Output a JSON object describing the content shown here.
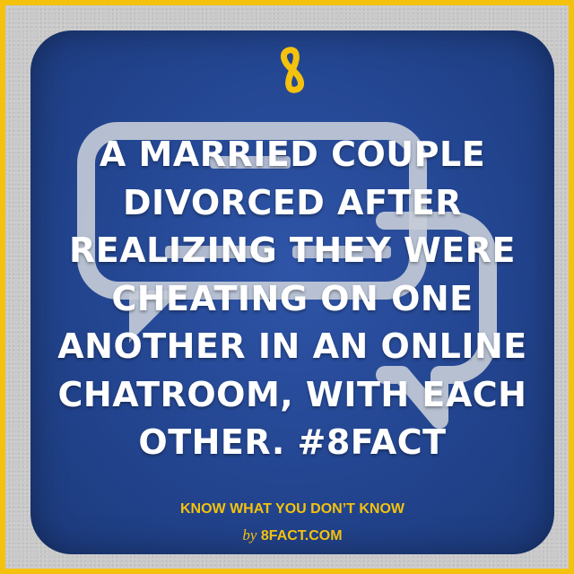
{
  "logo": {
    "icon": "8fact-logo-icon",
    "color": "#f4c20d"
  },
  "fact": {
    "lines": [
      "A MARRIED COUPLE",
      "DIVORCED AFTER",
      "REALIZING THEY WERE",
      "CHEATING ON ONE",
      "ANOTHER IN AN ONLINE",
      "CHATROOM, WITH EACH",
      "OTHER. #8FACT"
    ]
  },
  "footer": {
    "tagline": "KNOW WHAT YOU DON’T KNOW",
    "by": "by",
    "site": "8FACT.COM"
  },
  "colors": {
    "border": "#f4c20d",
    "panel": "#234590",
    "text": "#ffffff",
    "accent": "#f4c20d"
  }
}
